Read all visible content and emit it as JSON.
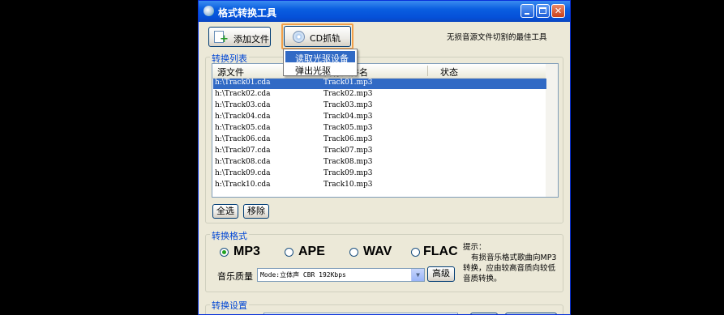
{
  "window": {
    "title": "格式转换工具"
  },
  "toolbar": {
    "add_file_label": "添加文件",
    "cd_rip_label": "CD抓轨",
    "tagline": "无损音源文件切割的最佳工具"
  },
  "cd_menu": {
    "items": [
      "读取光驱设备",
      "弹出光驱"
    ]
  },
  "conversion_list": {
    "group_label": "转换列表",
    "columns": [
      "源文件",
      "目标文件名",
      "状态"
    ],
    "rows": [
      {
        "source": "h:\\Track01.cda",
        "target": "Track01.mp3",
        "status": ""
      },
      {
        "source": "h:\\Track02.cda",
        "target": "Track02.mp3",
        "status": ""
      },
      {
        "source": "h:\\Track03.cda",
        "target": "Track03.mp3",
        "status": ""
      },
      {
        "source": "h:\\Track04.cda",
        "target": "Track04.mp3",
        "status": ""
      },
      {
        "source": "h:\\Track05.cda",
        "target": "Track05.mp3",
        "status": ""
      },
      {
        "source": "h:\\Track06.cda",
        "target": "Track06.mp3",
        "status": ""
      },
      {
        "source": "h:\\Track07.cda",
        "target": "Track07.mp3",
        "status": ""
      },
      {
        "source": "h:\\Track08.cda",
        "target": "Track08.mp3",
        "status": ""
      },
      {
        "source": "h:\\Track09.cda",
        "target": "Track09.mp3",
        "status": ""
      },
      {
        "source": "h:\\Track10.cda",
        "target": "Track10.mp3",
        "status": ""
      }
    ],
    "select_all_label": "全选",
    "remove_label": "移除"
  },
  "format": {
    "group_label": "转换格式",
    "options": [
      "MP3",
      "APE",
      "WAV",
      "FLAC"
    ],
    "selected": "MP3",
    "quality_label": "音乐质量",
    "quality_value": "Mode:立体声 CBR 192Kbps",
    "advanced_label": "高级",
    "tip_title": "提示：",
    "tip_lines": [
      "有损音乐格式歌曲向MP3",
      "转换，应由较高音质向较低",
      "音质转换。"
    ]
  },
  "settings": {
    "group_label": "转换设置"
  },
  "colors": {
    "title_bar": "#0a5ee0",
    "selection": "#316ac5",
    "group_label": "#0046d5",
    "window_bg": "#ece9d8"
  }
}
